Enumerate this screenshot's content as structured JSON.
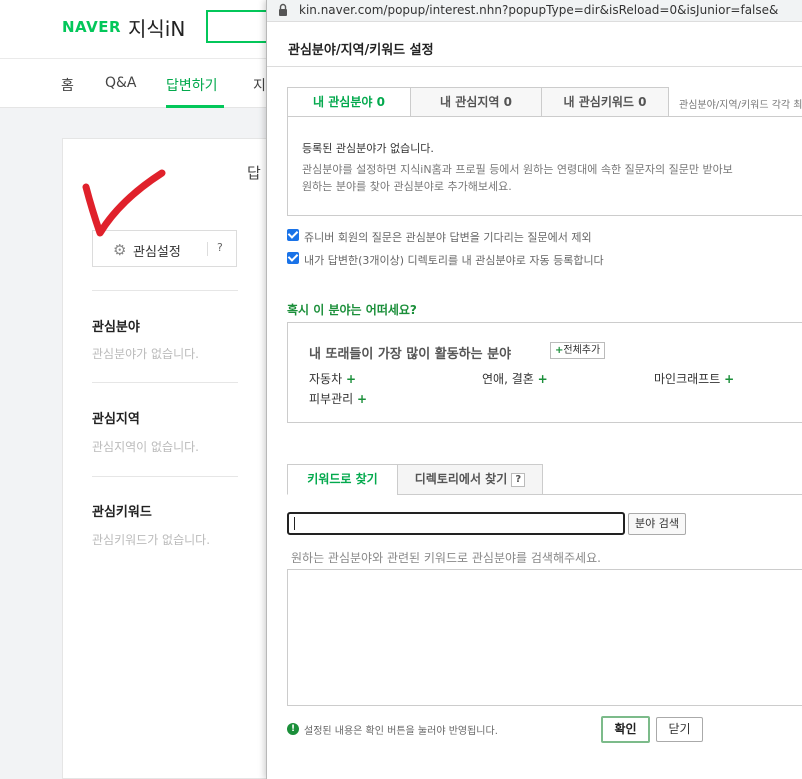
{
  "background": {
    "logo_naver": "NAVER",
    "logo_service": "지식iN",
    "nav": [
      "홈",
      "Q&A",
      "답변하기",
      "지"
    ],
    "card_title": "답",
    "interest_button": {
      "label": "관심설정",
      "help": "?"
    },
    "sections": [
      {
        "title": "관심분야",
        "empty": "관심분야가 없습니다."
      },
      {
        "title": "관심지역",
        "empty": "관심지역이 없습니다."
      },
      {
        "title": "관심키워드",
        "empty": "관심키워드가 없습니다."
      }
    ]
  },
  "popup": {
    "url": "kin.naver.com/popup/interest.nhn?popupType=dir&isReload=0&isJunior=false&",
    "title": "관심분야/지역/키워드 설정",
    "tabs": [
      "내 관심분야 0",
      "내 관심지역 0",
      "내 관심키워드 0"
    ],
    "tab_hint": "관심분야/지역/키워드 각각 최",
    "empty_box": {
      "line1": "등록된 관심분야가 없습니다.",
      "line2": "관심분야를 설정하면 지식iN홈과 프로필 등에서 원하는 연령대에 속한 질문자의 질문만 받아보",
      "line3": "원하는 분야를 찾아 관심분야로 추가해보세요."
    },
    "checkboxes": [
      {
        "label": "쥬니버 회원의 질문은 관심분야 답변을 기다리는 질문에서 제외",
        "checked": true
      },
      {
        "label": "내가 답변한(3개이상) 디렉토리를 내 관심분야로 자동 등록합니다",
        "checked": true
      }
    ],
    "suggest": {
      "title": "혹시 이 분야는 어떠세요?",
      "heading": "내 또래들이 가장 많이 활동하는 분야",
      "add_all": "전체추가",
      "categories": [
        "자동차",
        "연애, 결혼",
        "마인크래프트",
        "피부관리"
      ]
    },
    "search_tabs": {
      "keyword": "키워드로 찾기",
      "directory": "디렉토리에서 찾기",
      "help": "?"
    },
    "search": {
      "value": "",
      "button": "분야 검색",
      "hint": "원하는 관심분야와 관련된 키워드로 관심분야를 검색해주세요."
    },
    "footer": {
      "notice": "설정된 내용은 확인 버튼을 눌러야 반영됩니다.",
      "ok": "확인",
      "close": "닫기"
    }
  },
  "colors": {
    "naver_green": "#03c75a",
    "accent_green": "#1b8f3a",
    "checkbox_blue": "#1a73e8",
    "annotation_red": "#e0212b"
  }
}
